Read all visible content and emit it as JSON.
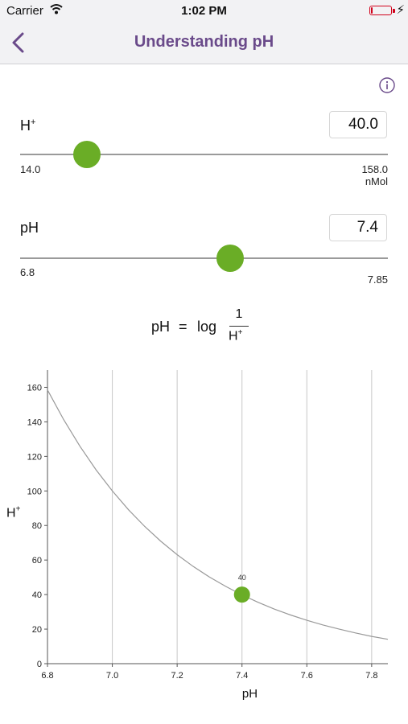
{
  "status_bar": {
    "carrier": "Carrier",
    "time": "1:02 PM",
    "battery_level": 0.08
  },
  "nav": {
    "title": "Understanding pH",
    "back_icon": "chevron-left-icon"
  },
  "info_icon": "info-circle-icon",
  "colors": {
    "accent": "#6a4a8a",
    "thumb": "#6aad26",
    "battery": "#d0021b"
  },
  "h_slider": {
    "label_main": "H",
    "label_sup": "+",
    "value": "40.0",
    "min_label": "14.0",
    "max_label": "158.0",
    "unit": "nMol",
    "min": 14.0,
    "max": 158.0,
    "current": 40.0
  },
  "ph_slider": {
    "label": "pH",
    "value": "7.4",
    "min_label": "6.8",
    "max_label": "7.85",
    "min": 6.8,
    "max": 7.85,
    "current": 7.4
  },
  "formula": {
    "lhs": "pH",
    "eq": "=",
    "log": "log",
    "numerator": "1",
    "denominator": "H",
    "denominator_sup": "+"
  },
  "chart_data": {
    "type": "line",
    "xlabel": "pH",
    "ylabel": "H",
    "ylabel_sup": "+",
    "xlim": [
      6.8,
      7.85
    ],
    "ylim": [
      0,
      170
    ],
    "x_ticks": [
      "6.8",
      "7.0",
      "7.2",
      "7.4",
      "7.6",
      "7.8"
    ],
    "y_ticks": [
      "0",
      "20",
      "40",
      "60",
      "80",
      "100",
      "120",
      "140",
      "160"
    ],
    "vertical_grid": true,
    "series": [
      {
        "x": [
          6.8,
          6.85,
          6.9,
          6.95,
          7.0,
          7.05,
          7.1,
          7.15,
          7.2,
          7.25,
          7.3,
          7.35,
          7.4,
          7.45,
          7.5,
          7.55,
          7.6,
          7.65,
          7.7,
          7.75,
          7.8,
          7.85
        ],
        "y": [
          158.5,
          141.3,
          125.9,
          112.2,
          100.0,
          89.1,
          79.4,
          70.8,
          63.1,
          56.2,
          50.1,
          44.7,
          39.8,
          35.5,
          31.6,
          28.2,
          25.1,
          22.4,
          20.0,
          17.8,
          15.8,
          14.1
        ]
      }
    ],
    "marker": {
      "x": 7.4,
      "y": 40,
      "label": "40"
    }
  }
}
